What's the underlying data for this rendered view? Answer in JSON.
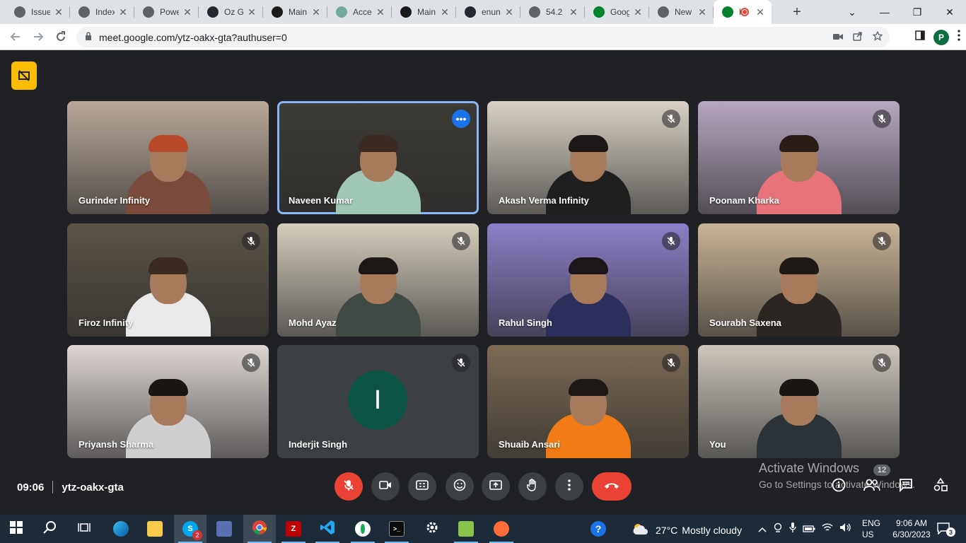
{
  "browser": {
    "tabs": [
      {
        "title": "Issue",
        "favicon": "globe-icon",
        "color": "#5f6368"
      },
      {
        "title": "Index",
        "favicon": "globe-icon",
        "color": "#5f6368"
      },
      {
        "title": "Powe",
        "favicon": "globe-icon",
        "color": "#5f6368"
      },
      {
        "title": "Oz G",
        "favicon": "github-icon",
        "color": "#24292f"
      },
      {
        "title": "Main",
        "favicon": "angular-icon",
        "color": "#1a1a1a"
      },
      {
        "title": "Acce",
        "favicon": "openai-icon",
        "color": "#74aa9c"
      },
      {
        "title": "Main",
        "favicon": "angular-icon",
        "color": "#1a1a1a"
      },
      {
        "title": "enun",
        "favicon": "github-icon",
        "color": "#24292f"
      },
      {
        "title": "54.2",
        "favicon": "globe-icon",
        "color": "#5f6368"
      },
      {
        "title": "Goog",
        "favicon": "google-meet-icon",
        "color": "#00832d"
      },
      {
        "title": "New",
        "favicon": "chrome-icon",
        "color": "#5f6368"
      },
      {
        "title": "M",
        "favicon": "google-meet-icon",
        "color": "#00832d",
        "active": true
      }
    ],
    "url": "meet.google.com/ytz-oakx-gta?authuser=0",
    "profile_initial": "P"
  },
  "meet": {
    "time": "09:06",
    "meeting_code": "ytz-oakx-gta",
    "participants_count": "12",
    "participants": [
      {
        "name": "Gurinder Infinity",
        "muted": false,
        "bg": "#b9a99a",
        "shirt": "#7a4a3c",
        "hair": "#b84a2a"
      },
      {
        "name": "Naveen Kumar",
        "muted": false,
        "pinned": true,
        "bg": "#3c3a34",
        "shirt": "#9fc7b4",
        "hair": "#3b2a22"
      },
      {
        "name": "Akash Verma Infinity",
        "muted": true,
        "bg": "#d9d1c4",
        "shirt": "#1f1f1f",
        "hair": "#1c1716"
      },
      {
        "name": "Poonam Kharka",
        "muted": true,
        "bg": "#b7a7c0",
        "shirt": "#e6727a",
        "hair": "#2a1d18"
      },
      {
        "name": "Firoz Infinity",
        "muted": true,
        "bg": "#5c5447",
        "shirt": "#e9e9e9",
        "hair": "#3a2a1f"
      },
      {
        "name": "Mohd Ayaz",
        "muted": true,
        "bg": "#d5cdbd",
        "shirt": "#3f4a44",
        "hair": "#1d1816"
      },
      {
        "name": "Rahul Singh",
        "muted": true,
        "bg": "#8d7fc9",
        "shirt": "#2c2f5b",
        "hair": "#1b1619"
      },
      {
        "name": "Sourabh Saxena",
        "muted": true,
        "bg": "#c9b497",
        "shirt": "#2c2622",
        "hair": "#1f1915"
      },
      {
        "name": "Priyansh Sharma",
        "muted": true,
        "bg": "#ded6d2",
        "shirt": "#cfcfcf",
        "hair": "#1a1614"
      },
      {
        "name": "Inderjit Singh",
        "muted": true,
        "avatar": "I",
        "avatar_color": "#0b5345"
      },
      {
        "name": "Shuaib Ansari",
        "muted": true,
        "bg": "#7c6a55",
        "shirt": "#f07b16",
        "hair": "#1d1816"
      },
      {
        "name": "You",
        "muted": true,
        "bg": "#cdc6bc",
        "shirt": "#2b3238",
        "hair": "#1a1614"
      }
    ],
    "controls": [
      "mic-off-icon",
      "camera-icon",
      "captions-icon",
      "emoji-icon",
      "present-icon",
      "raise-hand-icon",
      "more-options-icon",
      "hang-up-icon"
    ],
    "side_controls": [
      "info-icon",
      "people-icon",
      "chat-icon",
      "activities-icon"
    ]
  },
  "watermark": {
    "line1": "Activate Windows",
    "line2": "Go to Settings to activate Windows."
  },
  "taskbar": {
    "weather_temp": "27°C",
    "weather_text": "Mostly cloudy",
    "lang1": "ENG",
    "lang2": "US",
    "time": "9:06 AM",
    "date": "6/30/2023",
    "notifications": "3",
    "skype_badge": "2"
  }
}
